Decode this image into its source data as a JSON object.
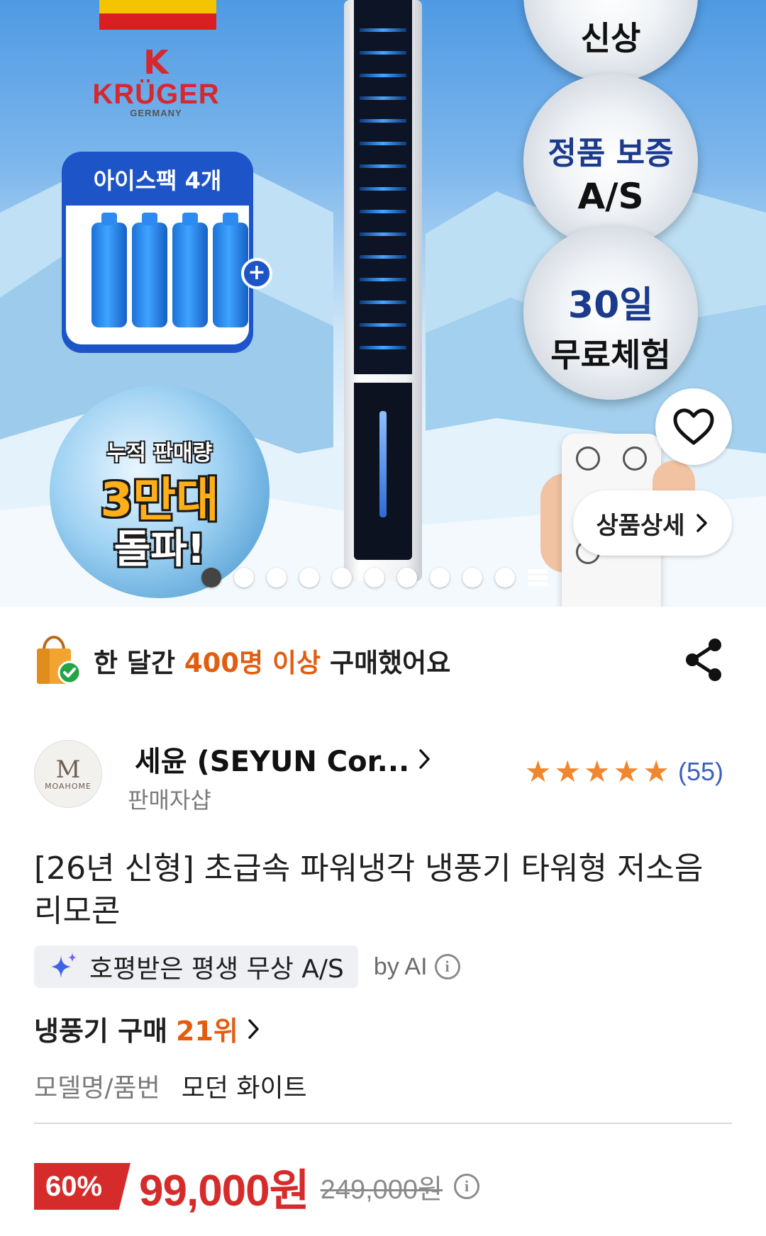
{
  "hero": {
    "brand_letter": "K",
    "brand_name": "KRÜGER",
    "brand_sub": "GERMANY",
    "icepack_title": "아이스팩 4개",
    "badge_new": "신상",
    "badge_warranty_1": "정품 보증",
    "badge_warranty_2": "A/S",
    "badge_trial_1": "30일",
    "badge_trial_2": "무료체험",
    "sales_1": "누적 판매량",
    "sales_2": "3만대",
    "sales_3": "돌파!",
    "detail_button": "상품상세",
    "carousel": {
      "total_dots": 10,
      "active_index": 0
    },
    "colors": {
      "brand_red": "#d6282e",
      "ice_blue": "#1d55c8"
    }
  },
  "purchase_notice": {
    "prefix": "한 달간",
    "highlight": "400명 이상",
    "suffix": "구매했어요"
  },
  "seller": {
    "logo_text": "MOAHOME",
    "name": "세윤 (SEYUN Cor...",
    "label": "판매자샵",
    "rating_stars": 5,
    "review_count": "(55)"
  },
  "product": {
    "title": "[26년 신형] 초급속 파워냉각 냉풍기 타워형 저소음 리모콘",
    "ai_summary": "호평받은 평생 무상 A/S",
    "ai_by": "by AI",
    "rank_prefix": "냉풍기 구매",
    "rank_value": "21위",
    "model_key": "모델명/품번",
    "model_value": "모던 화이트"
  },
  "price": {
    "discount": "60%",
    "sale": "99,000원",
    "original": "249,000원",
    "accent_color": "#d62b2b"
  },
  "icons": [
    "heart-icon",
    "chevron-right-icon",
    "shopping-bag-check-icon",
    "share-icon",
    "star-icon",
    "sparkle-icon",
    "info-icon"
  ]
}
